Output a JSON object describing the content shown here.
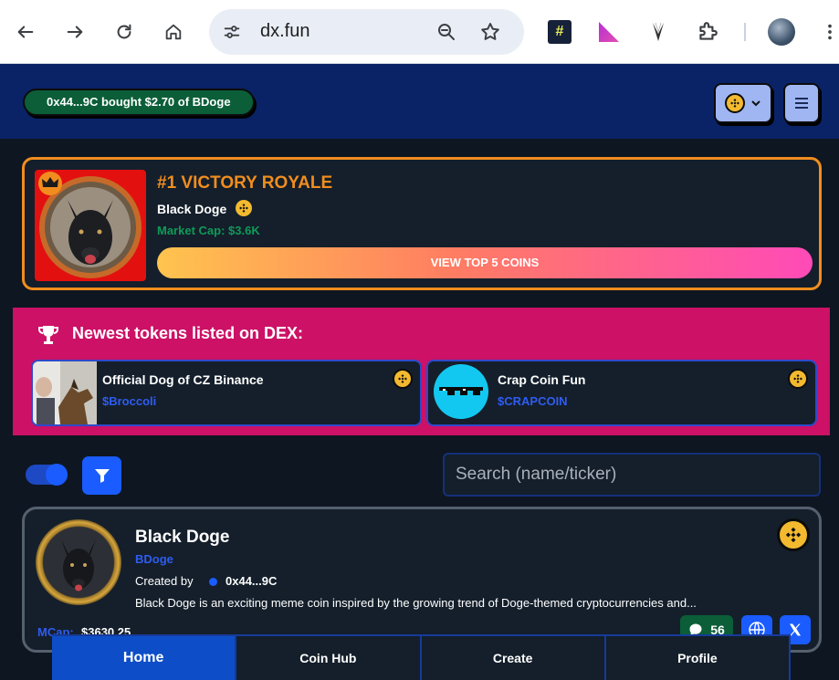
{
  "browser": {
    "url": "dx.fun"
  },
  "header": {
    "ticker_text": "0x44...9C bought $2.70 of BDoge"
  },
  "victory": {
    "title": "#1 VICTORY ROYALE",
    "coin_name": "Black Doge",
    "market_cap": "Market Cap: $3.6K",
    "cta": "VIEW TOP 5 COINS"
  },
  "newest": {
    "title": "Newest tokens listed on DEX:",
    "items": [
      {
        "name": "Official Dog of CZ Binance",
        "ticker": "$Broccoli"
      },
      {
        "name": "Crap Coin Fun",
        "ticker": "$CRAPCOIN"
      }
    ]
  },
  "filters": {
    "search_placeholder": "Search (name/ticker)"
  },
  "coin": {
    "name": "Black Doge",
    "ticker": "BDoge",
    "created_by_label": "Created by",
    "creator": "0x44...9C",
    "description": "Black Doge is an exciting meme coin inspired by the growing trend of Doge-themed cryptocurrencies and...",
    "mcap_label": "MCap:",
    "mcap_value": "$3630.25",
    "comments": "56"
  },
  "bottom_nav": {
    "home": "Home",
    "coin_hub": "Coin Hub",
    "create": "Create",
    "profile": "Profile"
  },
  "colors": {
    "header_bg": "#0a2367",
    "accent_orange": "#f18d1e",
    "accent_pink": "#cc1166",
    "accent_blue": "#1a5cff",
    "success_green": "#0b5e38",
    "bnb_yellow": "#f3ba2f"
  }
}
